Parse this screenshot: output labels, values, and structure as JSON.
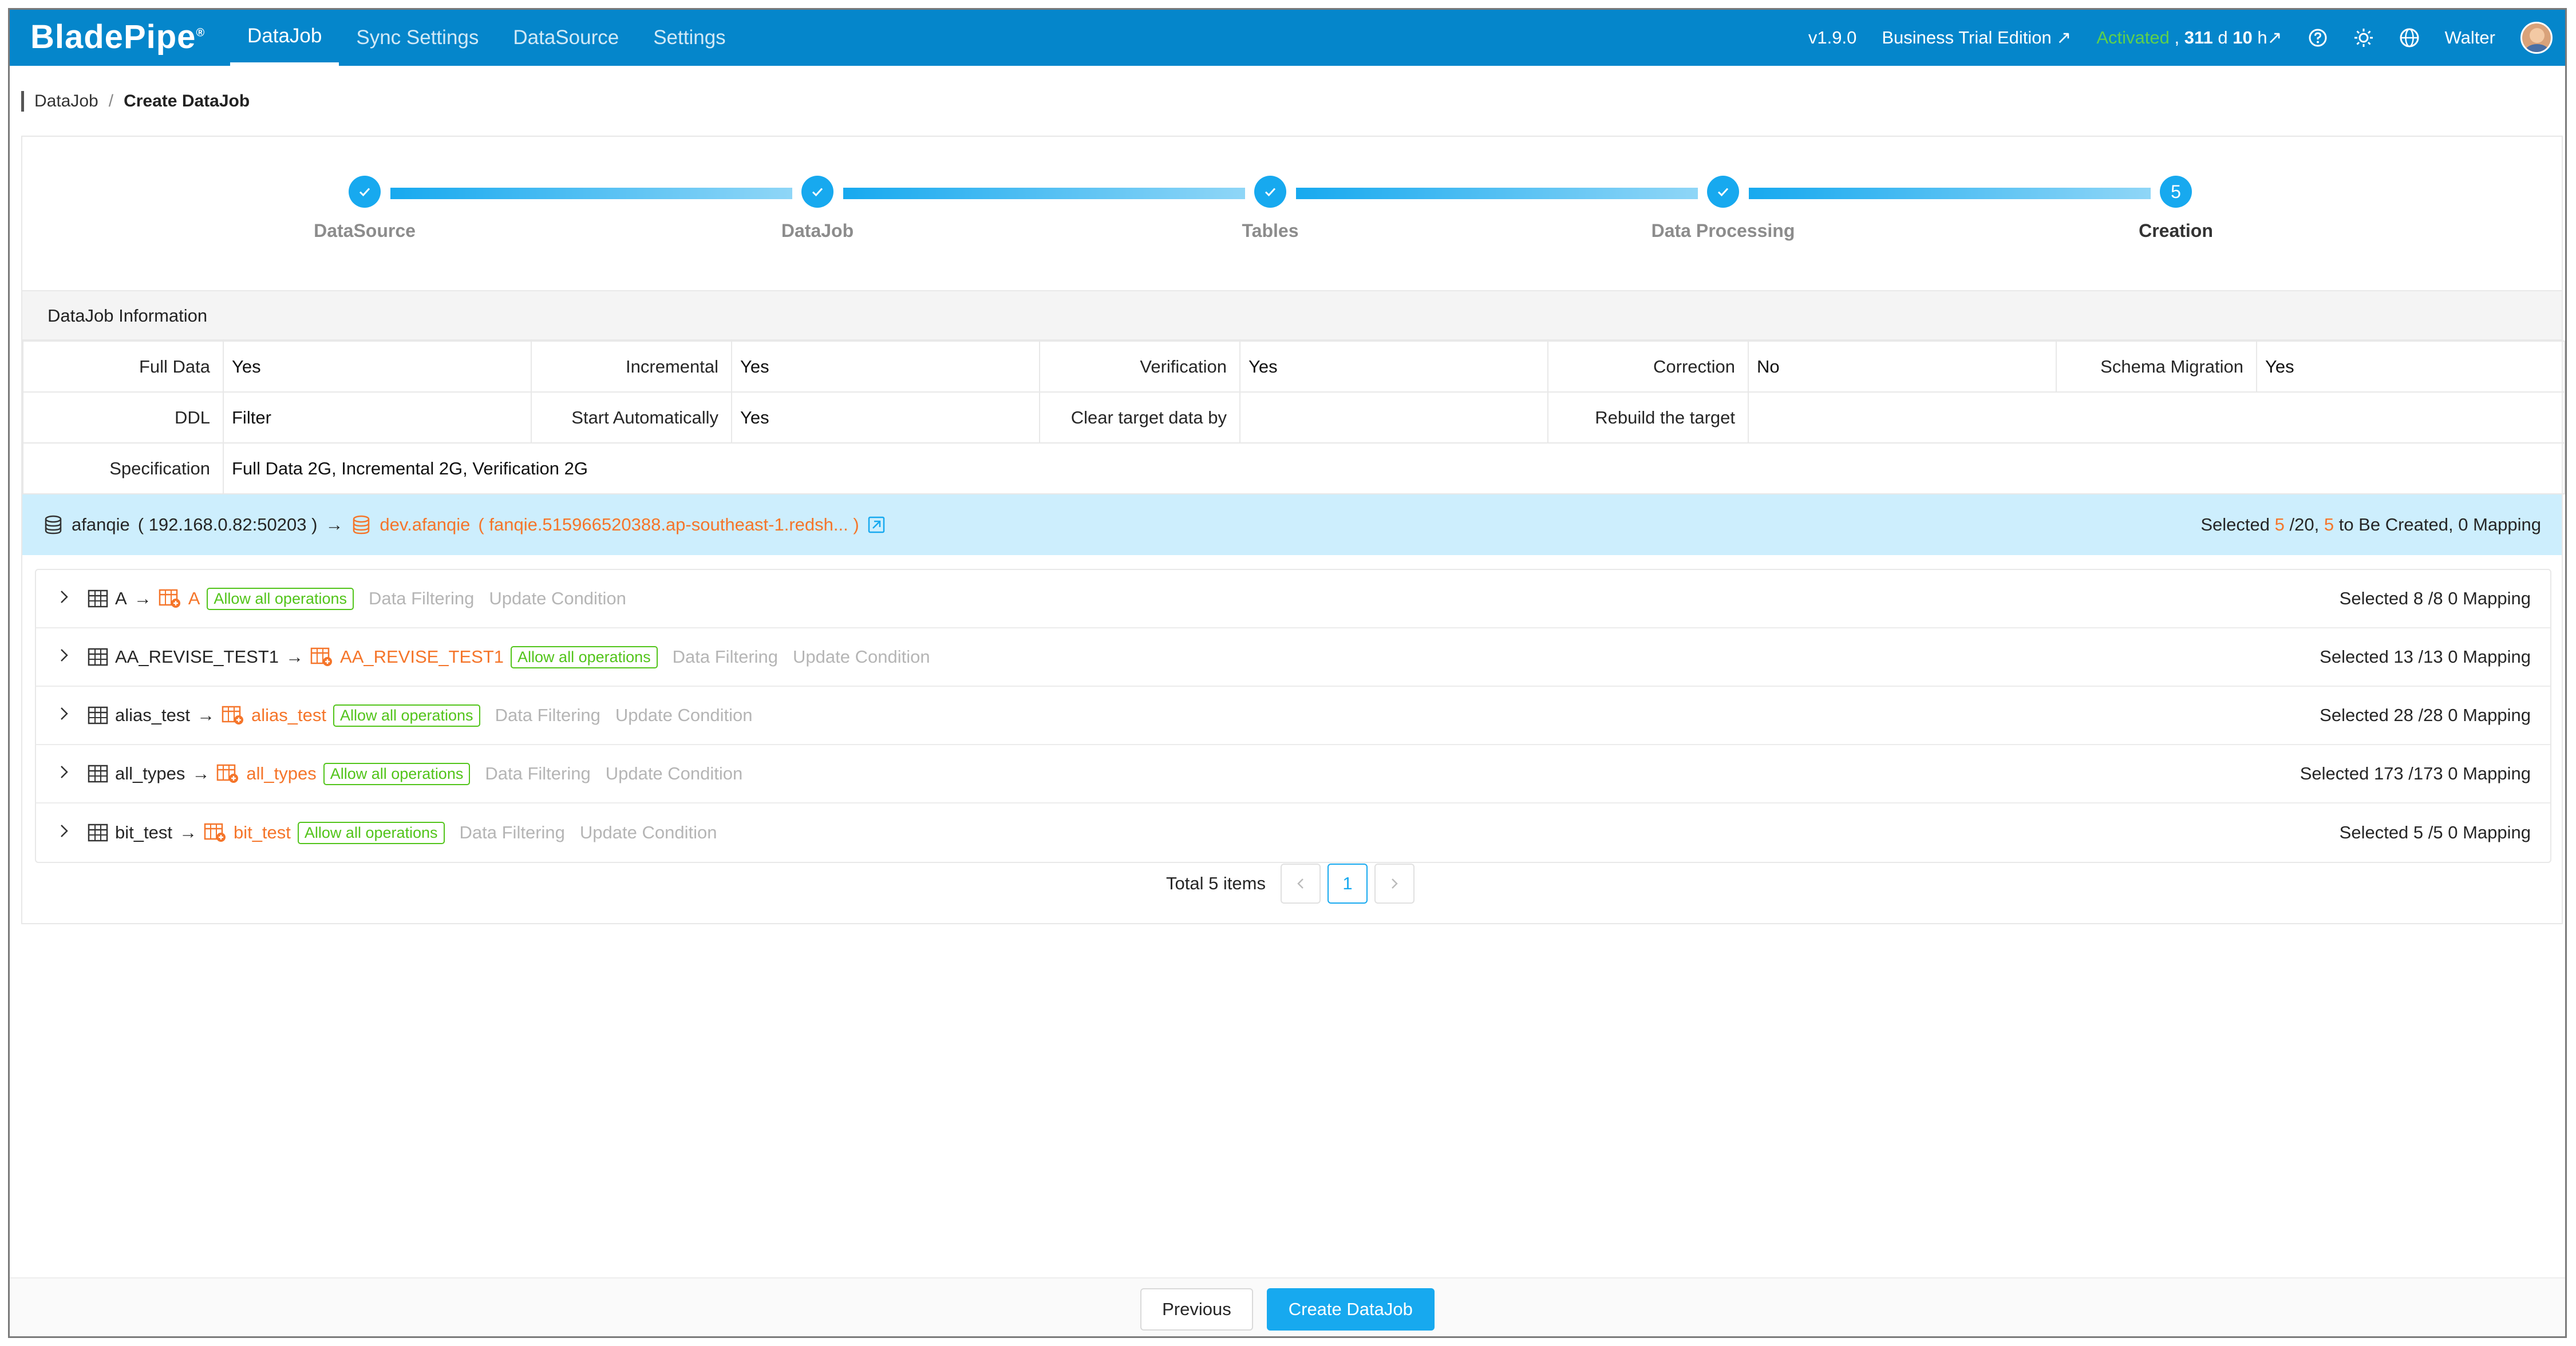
{
  "app": {
    "logo": "BladePipe",
    "logo_mark": "®",
    "nav": [
      {
        "label": "DataJob",
        "active": true
      },
      {
        "label": "Sync Settings",
        "active": false
      },
      {
        "label": "DataSource",
        "active": false
      },
      {
        "label": "Settings",
        "active": false
      }
    ],
    "version": "v1.9.0",
    "edition": "Business Trial Edition",
    "edition_arrow": "↗",
    "activated": "Activated",
    "days": "311",
    "days_unit": "d",
    "hours": "10",
    "hours_unit": "h",
    "days_arrow": "↗",
    "user": "Walter"
  },
  "breadcrumb": {
    "parent": "DataJob",
    "separator": "/",
    "current": "Create DataJob"
  },
  "steps": [
    {
      "label": "DataSource",
      "done": true
    },
    {
      "label": "DataJob",
      "done": true
    },
    {
      "label": "Tables",
      "done": true
    },
    {
      "label": "Data Processing",
      "done": true
    },
    {
      "label": "Creation",
      "done": false,
      "number": "5"
    }
  ],
  "info": {
    "header": "DataJob Information",
    "rows": [
      [
        {
          "key": "Full Data",
          "value": "Yes"
        },
        {
          "key": "Incremental",
          "value": "Yes"
        },
        {
          "key": "Verification",
          "value": "Yes"
        },
        {
          "key": "Correction",
          "value": "No"
        },
        {
          "key": "Schema Migration",
          "value": "Yes"
        }
      ],
      [
        {
          "key": "DDL",
          "value": "Filter"
        },
        {
          "key": "Start Automatically",
          "value": "Yes"
        },
        {
          "key": "Clear target data by",
          "value": ""
        },
        {
          "key": "Rebuild the target",
          "value": ""
        }
      ]
    ],
    "spec_key": "Specification",
    "spec_value": "Full Data 2G, Incremental 2G, Verification 2G"
  },
  "mapping": {
    "source_name": "afanqie",
    "source_addr": "( 192.168.0.82:50203 )",
    "arrow": "→",
    "target_name": "dev.afanqie",
    "target_addr": "( fanqie.515966520388.ap-southeast-1.redsh... )",
    "selected_label": "Selected",
    "selected_count": "5",
    "total": "/20,",
    "create_count": "5",
    "create_label": "to Be Created, 0 Mapping"
  },
  "tables": [
    {
      "source": "A",
      "target": "A",
      "tag": "Allow all operations",
      "filter": "Data Filtering",
      "update": "Update Condition",
      "status": "Selected 8 /8 0 Mapping"
    },
    {
      "source": "AA_REVISE_TEST1",
      "target": "AA_REVISE_TEST1",
      "tag": "Allow all operations",
      "filter": "Data Filtering",
      "update": "Update Condition",
      "status": "Selected 13 /13 0 Mapping"
    },
    {
      "source": "alias_test",
      "target": "alias_test",
      "tag": "Allow all operations",
      "filter": "Data Filtering",
      "update": "Update Condition",
      "status": "Selected 28 /28 0 Mapping"
    },
    {
      "source": "all_types",
      "target": "all_types",
      "tag": "Allow all operations",
      "filter": "Data Filtering",
      "update": "Update Condition",
      "status": "Selected 173 /173 0 Mapping"
    },
    {
      "source": "bit_test",
      "target": "bit_test",
      "tag": "Allow all operations",
      "filter": "Data Filtering",
      "update": "Update Condition",
      "status": "Selected 5 /5 0 Mapping"
    }
  ],
  "pagination": {
    "total": "Total 5 items",
    "current": "1"
  },
  "footer": {
    "previous": "Previous",
    "create": "Create DataJob"
  },
  "colors": {
    "nav_bg": "#0586cb",
    "accent": "#17a9ef",
    "target_orange": "#f5752a",
    "activated_green": "#5fd04c",
    "tag_green": "#52c41a",
    "banner_bg": "#cdeefd"
  },
  "icons": [
    "help-icon",
    "theme-icon",
    "language-icon",
    "database-icon",
    "table-icon",
    "target-table-icon",
    "chevron-right-icon",
    "check-icon",
    "link-icon"
  ]
}
